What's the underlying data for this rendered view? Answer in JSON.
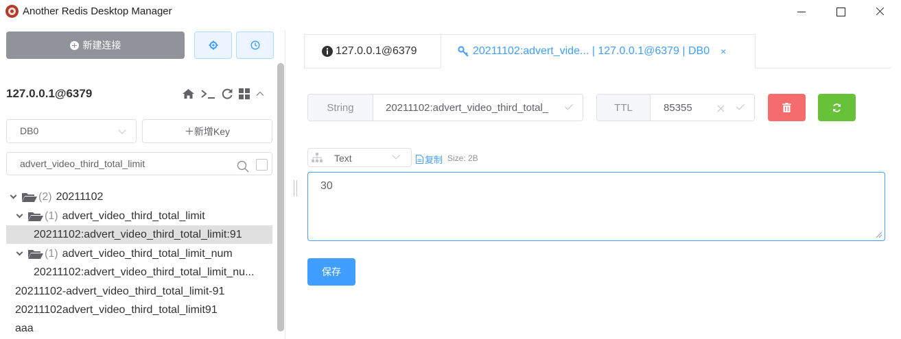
{
  "window": {
    "title": "Another Redis Desktop Manager"
  },
  "sidebar": {
    "new_connection_label": "新建连接",
    "connection_name": "127.0.0.1@6379",
    "db_selected": "DB0",
    "add_key_label": "＋新增Key",
    "search_value": "advert_video_third_total_limit",
    "tree": [
      {
        "count": "(2)",
        "label": "20211102"
      },
      {
        "count": "(1)",
        "label": "advert_video_third_total_limit"
      },
      {
        "label": "20211102:advert_video_third_total_limit:91"
      },
      {
        "count": "(1)",
        "label": "advert_video_third_total_limit_num"
      },
      {
        "label": "20211102:advert_video_third_total_limit_nu..."
      },
      {
        "label": "20211102-advert_video_third_total_limit-91"
      },
      {
        "label": "20211102advert_video_third_total_limit91"
      },
      {
        "label": "aaa"
      }
    ]
  },
  "tabs": [
    {
      "label": "127.0.0.1@6379"
    },
    {
      "label": "20211102:advert_vide... | 127.0.0.1@6379 | DB0",
      "close": "×"
    }
  ],
  "key_detail": {
    "type_label": "String",
    "key_name": "20211102:advert_video_third_total_",
    "ttl_label": "TTL",
    "ttl_value": "85355",
    "format_selected": "Text",
    "copy_label": "复制",
    "size_label": "Size: 2B",
    "value": "30",
    "save_label": "保存"
  },
  "colors": {
    "primary": "#409eff",
    "danger": "#f56c6c",
    "success": "#67c23a",
    "neutral": "#909399"
  }
}
